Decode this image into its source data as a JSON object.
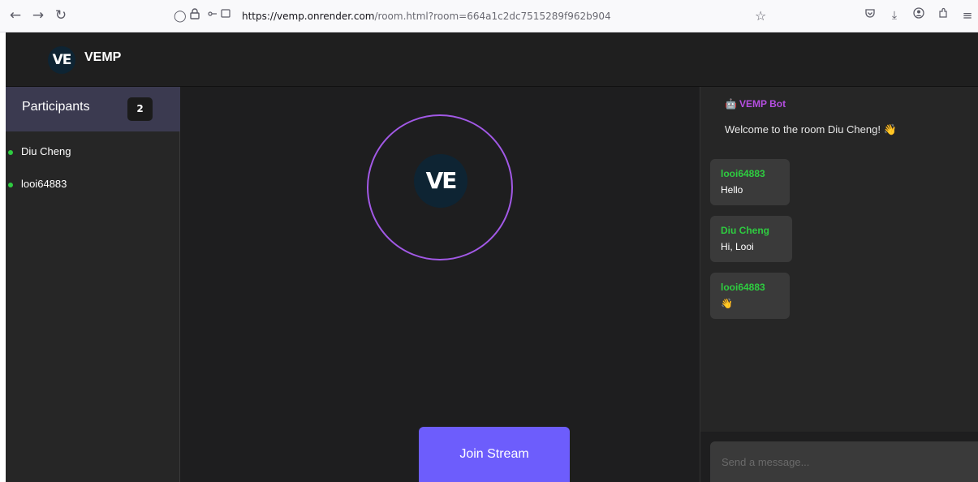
{
  "browser": {
    "url_host": "https://vemp.onrender.com",
    "url_path": "/room.html?room=664a1c2dc7515289f962b904",
    "icons": [
      "back-icon",
      "forward-icon",
      "reload-icon",
      "shield-icon",
      "lock-icon",
      "permissions-icon",
      "bookmark-star-icon",
      "pocket-icon",
      "download-icon",
      "account-icon",
      "extensions-icon",
      "menu-icon"
    ]
  },
  "app": {
    "logo_text": "VE",
    "brand": "VEMP"
  },
  "participants": {
    "title": "Participants",
    "count": "2",
    "list": [
      {
        "name": "Diu Cheng",
        "status_color": "#2ecc40"
      },
      {
        "name": "looi64883",
        "status_color": "#2ecc40"
      }
    ]
  },
  "stream": {
    "avatar_text": "VE",
    "join_label": "Join Stream",
    "accent": "#6d5dfc",
    "ring_color": "#a259e6"
  },
  "chat": {
    "bot_name": "VEMP Bot",
    "bot_message": "Welcome to the room Diu Cheng! 👋",
    "messages": [
      {
        "author": "looi64883",
        "text": "Hello"
      },
      {
        "author": "Diu Cheng",
        "text": "Hi, Looi"
      },
      {
        "author": "looi64883",
        "text": "👋"
      }
    ],
    "input_placeholder": "Send a message...",
    "author_color": "#2ecc40",
    "bot_color": "#b44ee0"
  }
}
